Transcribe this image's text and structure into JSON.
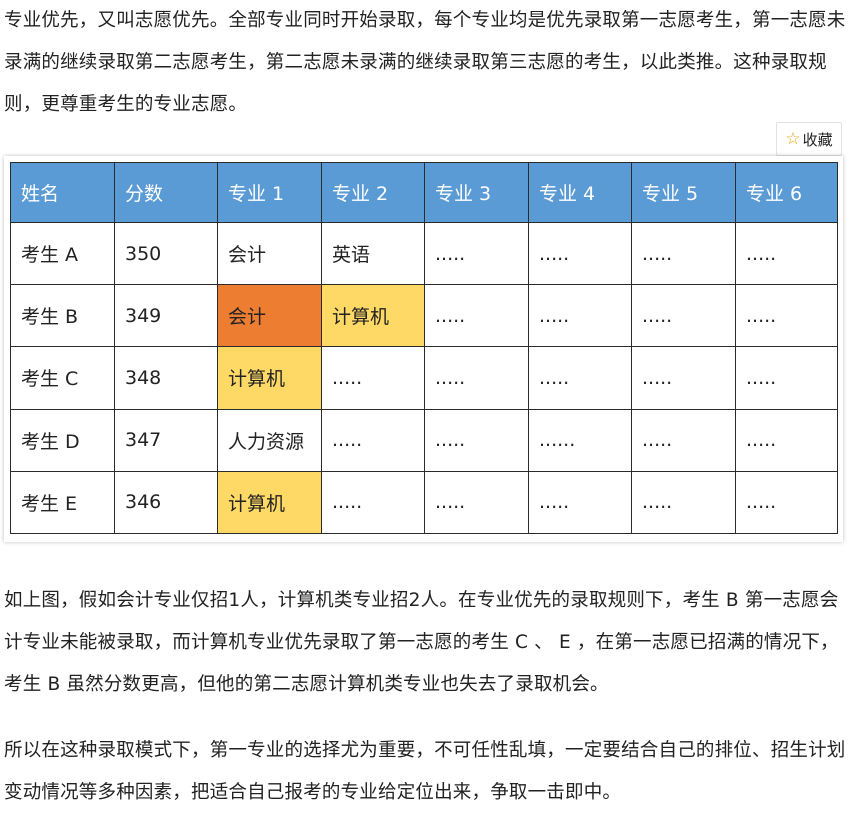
{
  "intro": "专业优先，又叫志愿优先。全部专业同时开始录取，每个专业均是优先录取第一志愿考生，第一志愿未录满的继续录取第二志愿考生，第二志愿未录满的继续录取第三志愿的考生，以此类推。这种录取规则，更尊重考生的专业志愿。",
  "collect": {
    "icon": "star-icon",
    "label": "收藏"
  },
  "table": {
    "headers": [
      "姓名",
      "分数",
      "专业 1",
      "专业 2",
      "专业 3",
      "专业 4",
      "专业 5",
      "专业 6"
    ],
    "rows": [
      [
        "考生 A",
        "350",
        "会计",
        "英语",
        ".....",
        ".....",
        ".....",
        "....."
      ],
      [
        "考生 B",
        "349",
        "会计",
        "计算机",
        ".....",
        ".....",
        ".....",
        "....."
      ],
      [
        "考生 C",
        "348",
        "计算机",
        ".....",
        ".....",
        ".....",
        ".....",
        "....."
      ],
      [
        "考生 D",
        "347",
        "人力资源",
        ".....",
        ".....",
        "......",
        ".....",
        "....."
      ],
      [
        "考生 E",
        "346",
        "计算机",
        ".....",
        ".....",
        ".....",
        ".....",
        "....."
      ]
    ],
    "colors": {
      "header_bg": "#5b9bd5",
      "rejected": "#ed7d31",
      "admitted": "#ffd966"
    }
  },
  "explain": "如上图，假如会计专业仅招1人，计算机类专业招2人。在专业优先的录取规则下，考生 B 第一志愿会计专业未能被录取，而计算机专业优先录取了第一志愿的考生 C 、 E ，在第一志愿已招满的情况下，考生 B 虽然分数更高，但他的第二志愿计算机类专业也失去了录取机会。",
  "conclusion": "所以在这种录取模式下，第一专业的选择尤为重要，不可任性乱填，一定要结合自己的排位、招生计划变动情况等多种因素，把适合自己报考的专业给定位出来，争取一击即中。"
}
